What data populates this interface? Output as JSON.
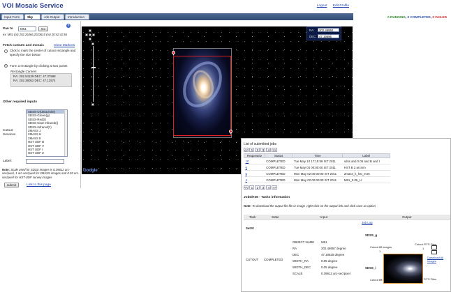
{
  "app": {
    "title": "VOI Mosaic Service",
    "logout": "Logout",
    "edit_profile": "Edit Profile"
  },
  "tabs": [
    {
      "label": "Input Form"
    },
    {
      "label": "Sky Map"
    },
    {
      "label": "Job Output"
    },
    {
      "label": "Introduction"
    }
  ],
  "status": {
    "running": "0 RUNNING",
    "completed": "0 COMPLETED",
    "failed": "0 FAILED",
    "sep": ", "
  },
  "form": {
    "pan_to_label": "Pan to",
    "pan_value": "M51",
    "go_label": "Go",
    "example": "ex: M51 (or) 202.26466,2023610 (or) 20:42:41:56",
    "fetch_heading": "Fetch cutouts and mosaic",
    "clear_markers": "Clear Markers",
    "radio1": "Click to mark the center of cutout rectangle and specify the size below",
    "radio2": "Form a rectangle by clicking at two points",
    "rect_title": "Rectangle Corners",
    "corner1": "RA: 202.54139 DEC: 47.37588",
    "corner2": "RA: 202.38052 DEC: 47.12574",
    "other_heading": "Other required inputs",
    "cutout_services_label": "Cutout Services",
    "services": [
      "SDSS-U(Ultraviolet)",
      "SDSS-Green(g)",
      "SDSS-Red(r)",
      "SDSS-Near Infrared(i)",
      "SDSS-Infrared(z)",
      "2MASS J",
      "2MASS H",
      "2MASS K",
      "HST UDF B",
      "HST UDF V",
      "HST UDF I",
      "HST UDF Z"
    ],
    "label_label": "Label:",
    "label_value": "",
    "note_bold": "Note:",
    "note_text": "Scale used for SDSS images is 0.39612 arc-sec/pixel, 1 arc-sec/pixel for 2MASS images and 0.03 arc-sec/pixel for HST-UDF survey images",
    "submit": "submit",
    "link_page": "Link to this page"
  },
  "map": {
    "ra_label": "RA:",
    "ra_value": "202.46850",
    "dec_label": "DEC:",
    "dec_value": "47.19596",
    "google": "Google"
  },
  "jobs": {
    "title": "List of submitted jobs",
    "pager": [
      "<<",
      "1",
      "2",
      "3",
      "4",
      ">>"
    ],
    "columns": [
      "RequestID",
      "Status",
      "Time",
      "Label"
    ],
    "rows": [
      {
        "id": "10",
        "status": "COMPLETED",
        "time": "Tue May 10 17:15:59 IST 2011",
        "label": "sdss and 0.05 and B and I"
      },
      {
        "id": "6",
        "status": "COMPLETED",
        "time": "Tue May 03 00:00:00 IST 2011",
        "label": "HST B 2 arcmin"
      },
      {
        "id": "5",
        "status": "COMPLETED",
        "time": "Mon May 02 00:00:00 IST 2011",
        "label": "2mass_k_hst_0.05"
      },
      {
        "id": "4",
        "status": "COMPLETED",
        "time": "Mon May 02 00:00:00 IST 2011",
        "label": "M51_0.05_U"
      }
    ],
    "tasks_title": "JobId#26 - Tasks information",
    "tasks_note_b": "Note:",
    "tasks_note": "To download the output fits file or image ,right click on the output link and click save as option",
    "task_columns": [
      "Task",
      "State",
      "Input",
      "Output"
    ],
    "job_log": "Job Log",
    "set": "Set#0",
    "task": "CUTOUT",
    "state": "COMPLETED",
    "params": [
      {
        "k": "OBJECT NAME",
        "v": "M51"
      },
      {
        "k": "RA",
        "v": "202.46957 degree"
      },
      {
        "k": "DEC",
        "v": "47.19525 degree"
      },
      {
        "k": "WIDTH_RA",
        "v": "0.05 degree"
      },
      {
        "k": "WIDTH_DEC",
        "v": "0.05 degree"
      },
      {
        "k": "SCALE",
        "v": "0.39612 arc-sec/pixel"
      }
    ],
    "out_sdss_g": "SDSS_g",
    "out_sdss_i": "SDSS_i",
    "cutout_images": "Cutout tiff images",
    "cutout_images2": "Cutout tiff images",
    "cutout_fits": "Cutout FITS Files",
    "cutout_fits2": "Cutout FITS Files",
    "bullet": "1",
    "bullet2": "1",
    "download_all": "Download All images"
  }
}
